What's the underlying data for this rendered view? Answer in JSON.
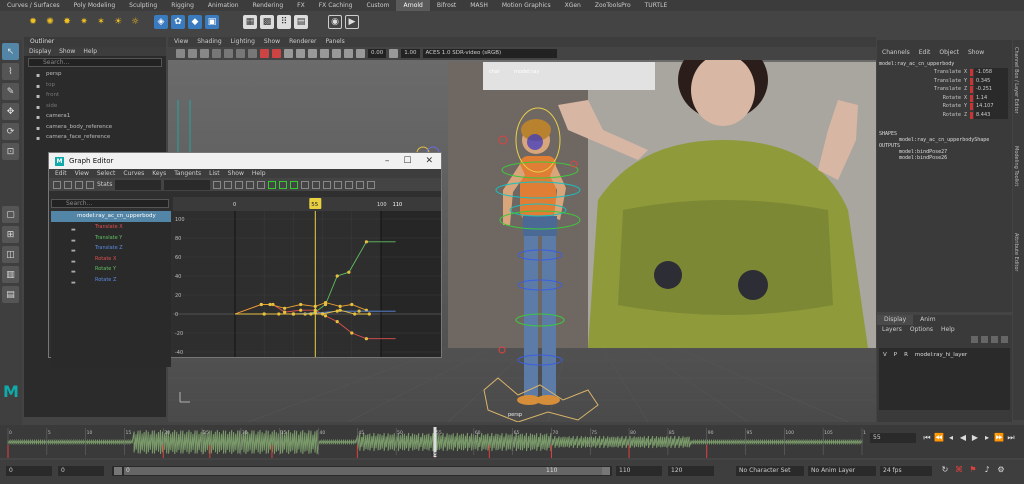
{
  "shelf": {
    "tabs": [
      "Curves / Surfaces",
      "Poly Modeling",
      "Sculpting",
      "Rigging",
      "Animation",
      "Rendering",
      "FX",
      "FX Caching",
      "Custom",
      "Arnold",
      "Bifrost",
      "MASH",
      "Motion Graphics",
      "XGen",
      "ZooToolsPro",
      "TURTLE"
    ],
    "active_tab": "Arnold"
  },
  "outliner": {
    "title": "Outliner",
    "menu": [
      "Display",
      "Show",
      "Help"
    ],
    "search_placeholder": "Search...",
    "items": [
      "persp",
      "top",
      "front",
      "side",
      "camera1",
      "camera_body_reference",
      "camera_face_reference"
    ]
  },
  "viewport": {
    "menu": [
      "View",
      "Shading",
      "Lighting",
      "Show",
      "Renderer",
      "Panels"
    ],
    "field_1": "0.00",
    "field_2": "1.00",
    "color_space": "ACES 1.0 SDR-video (sRGB)",
    "camera_name": "persp",
    "label_1": "char",
    "label_2": "model:ray"
  },
  "graph_editor": {
    "title": "Graph Editor",
    "menu": [
      "Edit",
      "View",
      "Select",
      "Curves",
      "Keys",
      "Tangents",
      "List",
      "Show",
      "Help"
    ],
    "stats_label": "Stats",
    "search_placeholder": "Search...",
    "node": "model:ray_ac_cn_upperbody",
    "curves": [
      {
        "name": "Translate X",
        "color": "#e05050"
      },
      {
        "name": "Translate Y",
        "color": "#60c060"
      },
      {
        "name": "Translate Z",
        "color": "#5a8ae0"
      },
      {
        "name": "Rotate X",
        "color": "#e05050"
      },
      {
        "name": "Rotate Y",
        "color": "#60c060"
      },
      {
        "name": "Rotate Z",
        "color": "#5a8ae0"
      }
    ],
    "current_frame": "55",
    "frame_0": "0",
    "frame_100": "100",
    "frame_end": "110",
    "y_ticks": [
      "100",
      "80",
      "60",
      "40",
      "20",
      "0",
      "-20",
      "-40"
    ]
  },
  "channel_box": {
    "tabs": [
      "Channels",
      "Edit",
      "Object",
      "Show"
    ],
    "node": "model:ray_ac_cn_upperbody",
    "channels": [
      {
        "label": "Translate X",
        "value": "-1.058"
      },
      {
        "label": "Translate Y",
        "value": "0.345"
      },
      {
        "label": "Translate Z",
        "value": "-0.251"
      },
      {
        "label": "Rotate X",
        "value": "1.14"
      },
      {
        "label": "Rotate Y",
        "value": "14.107"
      },
      {
        "label": "Rotate Z",
        "value": "8.443"
      }
    ],
    "shapes_header": "SHAPES",
    "shape": "model:ray_ac_cn_upperbodyShape",
    "outputs_header": "OUTPUTS",
    "outputs": [
      "model:bindPose27",
      "model:bindPose26"
    ]
  },
  "layer_editor": {
    "tabs": [
      "Display",
      "Anim"
    ],
    "menu": [
      "Layers",
      "Options",
      "Help"
    ],
    "layer": {
      "v": "V",
      "p": "P",
      "r": "R",
      "name": "model:ray_hi_layer"
    }
  },
  "side_tabs": [
    "Channel Box / Layer Editor",
    "Modeling Toolkit",
    "Attribute Editor"
  ],
  "timeline": {
    "ticks": [
      "0",
      "5",
      "10",
      "15",
      "20",
      "25",
      "30",
      "35",
      "40",
      "45",
      "50",
      "55",
      "60",
      "65",
      "70",
      "75",
      "80",
      "85",
      "90",
      "95",
      "100",
      "105",
      "110"
    ],
    "current": "55",
    "current_field": "55"
  },
  "range": {
    "start": "0",
    "start2": "0",
    "range_start_label": "0",
    "range_end_label": "110",
    "end1": "110",
    "end2": "120",
    "character_set": "No Character Set",
    "anim_layer": "No Anim Layer",
    "fps": "24 fps"
  }
}
